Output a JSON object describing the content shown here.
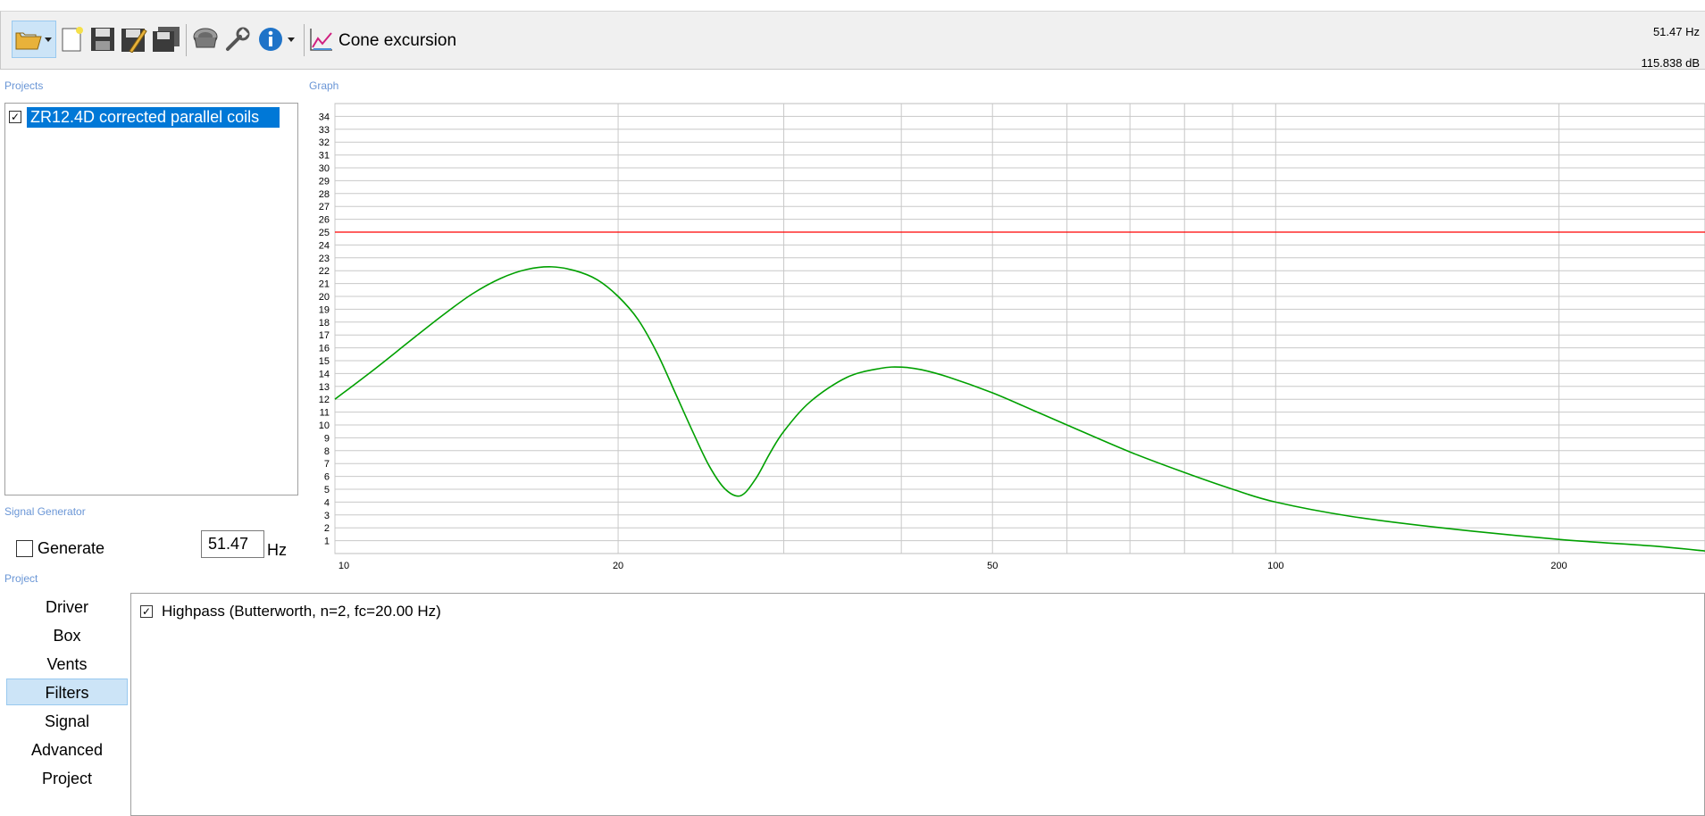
{
  "toolbar": {
    "title": "Cone excursion",
    "readout_freq": "51.47 Hz",
    "readout_level": "115.838 dB",
    "icons": [
      "open-folder-icon",
      "new-document-icon",
      "save-icon",
      "save-as-icon",
      "save-all-icon",
      "speaker-driver-icon",
      "wrench-icon",
      "info-icon",
      "graph-type-icon"
    ]
  },
  "sections": {
    "projects": "Projects",
    "graph": "Graph",
    "signal_generator": "Signal Generator",
    "project": "Project"
  },
  "projects": {
    "items": [
      {
        "label": "ZR12.4D corrected parallel coils",
        "checked": true
      }
    ]
  },
  "signal_generator": {
    "generate_label": "Generate",
    "generate_checked": false,
    "frequency_value": "51.47",
    "frequency_unit": "Hz"
  },
  "nav": {
    "items": [
      "Driver",
      "Box",
      "Vents",
      "Filters",
      "Signal",
      "Advanced",
      "Project"
    ],
    "selected": "Filters"
  },
  "filters": {
    "items": [
      {
        "label": "Highpass (Butterworth, n=2, fc=20.00 Hz)",
        "checked": true
      }
    ]
  },
  "chart_data": {
    "type": "line",
    "xscale": "log",
    "xlim": [
      10,
      286
    ],
    "ylim": [
      0,
      35
    ],
    "x_tick_labels": [
      "10",
      "20",
      "50",
      "100",
      "200"
    ],
    "x_ticks": [
      10,
      20,
      50,
      100,
      200
    ],
    "x_gridlines": [
      10,
      20,
      30,
      40,
      50,
      60,
      70,
      80,
      90,
      100,
      200
    ],
    "y_tick_labels": [
      "1",
      "2",
      "3",
      "4",
      "5",
      "6",
      "7",
      "8",
      "9",
      "10",
      "11",
      "12",
      "13",
      "14",
      "15",
      "16",
      "17",
      "18",
      "19",
      "20",
      "21",
      "22",
      "23",
      "24",
      "25",
      "26",
      "27",
      "28",
      "29",
      "30",
      "31",
      "32",
      "33",
      "34"
    ],
    "grid": true,
    "series": [
      {
        "color": "#00a000",
        "x": [
          10,
          11,
          12,
          13,
          14,
          15,
          16,
          17,
          18,
          19,
          20,
          21,
          22,
          23,
          24,
          25,
          26,
          27,
          28,
          29,
          30,
          32,
          35,
          38,
          40,
          42,
          45,
          50,
          55,
          60,
          70,
          80,
          90,
          100,
          120,
          150,
          200,
          250,
          286
        ],
        "y": [
          12,
          14.3,
          16.5,
          18.5,
          20.2,
          21.4,
          22.1,
          22.3,
          22.0,
          21.3,
          20.0,
          18.2,
          15.6,
          12.5,
          9.5,
          6.8,
          5.0,
          4.5,
          5.8,
          7.8,
          9.5,
          11.8,
          13.7,
          14.4,
          14.5,
          14.3,
          13.7,
          12.5,
          11.2,
          10.0,
          7.9,
          6.3,
          5.0,
          4.0,
          2.9,
          2.0,
          1.1,
          0.6,
          0.2
        ]
      },
      {
        "color": "#ff0000",
        "x": [
          10,
          286
        ],
        "y": [
          25,
          25
        ]
      }
    ]
  }
}
